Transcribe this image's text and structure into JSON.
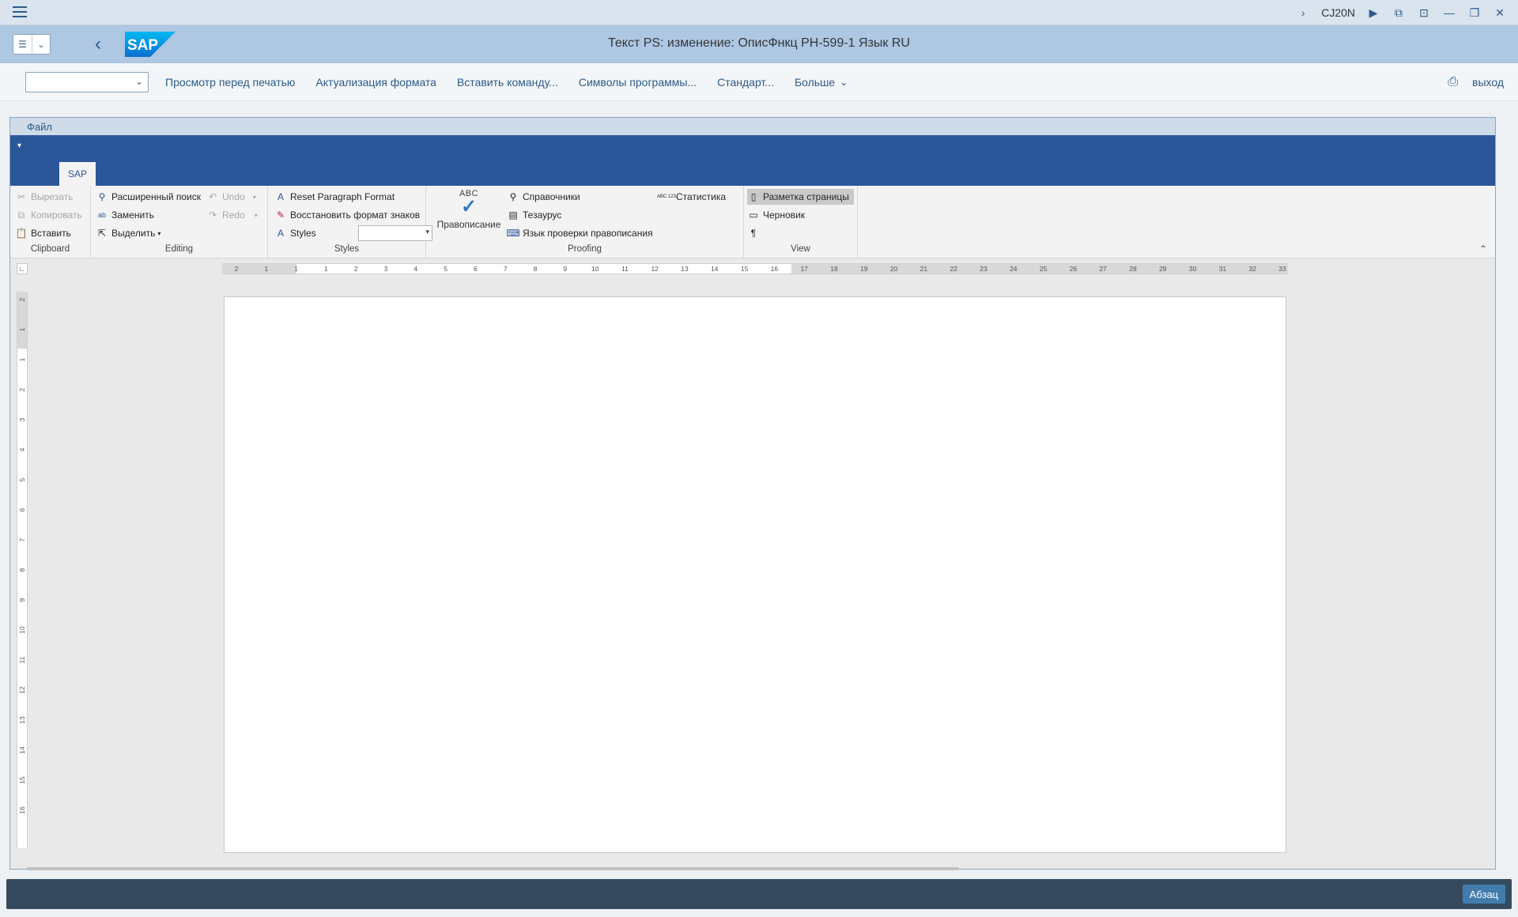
{
  "system": {
    "tcode": "CJ20N",
    "icons": [
      "menu-icon",
      "chevron-right-icon",
      "play-icon",
      "layout-icon",
      "unlock-icon",
      "minimize-icon",
      "restore-icon",
      "close-icon"
    ]
  },
  "header": {
    "title": "Текст PS: изменение: ОписФнкц PH-599-1 Язык RU",
    "logo_text": "SAP"
  },
  "toolbar": {
    "buttons": [
      "Просмотр перед печатью",
      "Актуализация формата",
      "Вставить команду...",
      "Символы программы...",
      "Стандарт...",
      "Больше"
    ],
    "exit_label": "выход"
  },
  "word": {
    "file_menu": "Файл",
    "tab": "SAP",
    "groups": {
      "clipboard": {
        "label": "Clipboard",
        "cut": "Вырезать",
        "copy": "Копировать",
        "paste": "Вставить"
      },
      "editing": {
        "label": "Editing",
        "advanced_find": "Расширенный поиск",
        "replace": "Заменить",
        "select": "Выделить",
        "undo": "Undo",
        "redo": "Redo"
      },
      "styles": {
        "label": "Styles",
        "reset_paragraph": "Reset Paragraph Format",
        "restore_chars": "Восстановить формат знаков",
        "styles": "Styles"
      },
      "proofing": {
        "label": "Proofing",
        "spelling_abc": "ABC",
        "spelling": "Правописание",
        "research": "Справочники",
        "thesaurus": "Тезаурус",
        "language": "Язык проверки правописания",
        "statistics": "Статистика",
        "stats_abc": "ABC 123"
      },
      "view": {
        "label": "View",
        "print_layout": "Разметка страницы",
        "draft": "Черновик",
        "pilcrow": "¶"
      }
    },
    "ruler_h": [
      "2",
      "1",
      "1",
      "1",
      "2",
      "3",
      "4",
      "5",
      "6",
      "7",
      "8",
      "9",
      "10",
      "11",
      "12",
      "13",
      "14",
      "15",
      "16",
      "17",
      "18",
      "19",
      "20",
      "21",
      "22",
      "23",
      "24",
      "25",
      "26",
      "27",
      "28",
      "29",
      "30",
      "31",
      "32",
      "33"
    ],
    "ruler_v": [
      "2",
      "1",
      "1",
      "2",
      "3",
      "4",
      "5",
      "6",
      "7",
      "8",
      "9",
      "10",
      "11",
      "12",
      "13",
      "14",
      "15",
      "16"
    ]
  },
  "status": {
    "mode": "Абзац"
  }
}
